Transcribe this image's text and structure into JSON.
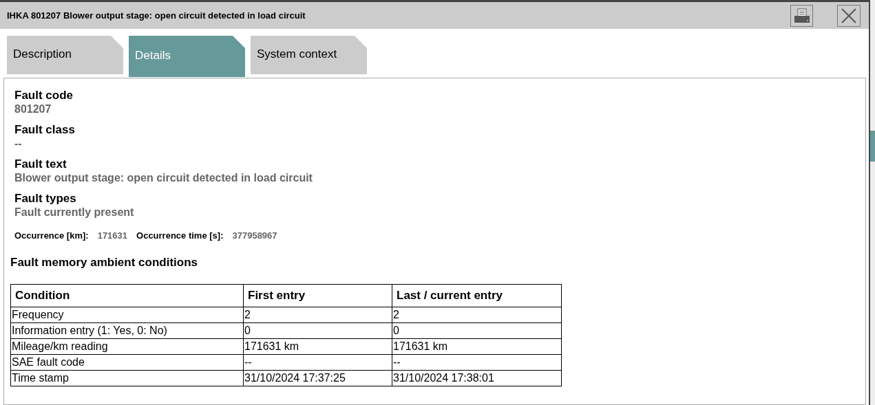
{
  "window": {
    "title": "IHKA 801207 Blower output stage: open circuit detected in load circuit"
  },
  "tabs": [
    {
      "label": "Description",
      "selected": false
    },
    {
      "label": "Details",
      "selected": true
    },
    {
      "label": "System context",
      "selected": false
    }
  ],
  "fields": [
    {
      "label": "Fault code",
      "value": "801207"
    },
    {
      "label": "Fault class",
      "value": "--"
    },
    {
      "label": "Fault text",
      "value": "Blower output stage: open circuit detected in load circuit"
    },
    {
      "label": "Fault types",
      "value": "Fault currently present"
    }
  ],
  "occurrence": [
    {
      "label": "Occurrence [km]:",
      "value": "171631"
    },
    {
      "label": "Occurrence time [s]:",
      "value": "377958967"
    }
  ],
  "section_title": "Fault memory ambient conditions",
  "table": {
    "columns": [
      "Condition",
      "First entry",
      "Last / current entry"
    ],
    "rows": [
      [
        "Frequency",
        "2",
        "2"
      ],
      [
        "Information entry (1: Yes, 0: No)",
        "0",
        "0"
      ],
      [
        "Mileage/km reading",
        "171631 km",
        "171631 km"
      ],
      [
        "SAE fault code",
        "--",
        "--"
      ],
      [
        "Time stamp",
        "31/10/2024 17:37:25",
        "31/10/2024 17:38:01"
      ]
    ]
  }
}
